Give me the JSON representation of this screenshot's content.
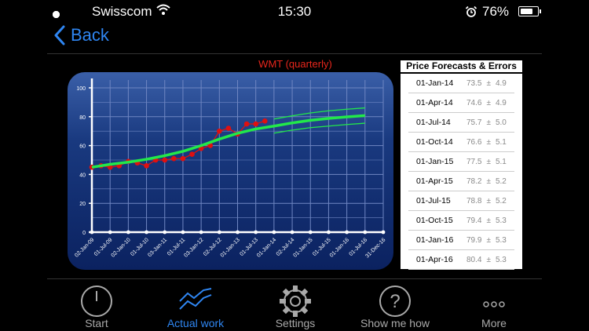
{
  "status": {
    "carrier": "Swisscom",
    "time": "15:30",
    "battery": "76%",
    "signal_bars": 2,
    "signal_max": 5,
    "battery_level": 0.76
  },
  "nav": {
    "back_label": "Back"
  },
  "chart_data": {
    "type": "line",
    "title": "WMT (quarterly)",
    "ylim": [
      0,
      100
    ],
    "y_ticks": [
      0,
      20,
      40,
      60,
      80,
      100
    ],
    "grid": true,
    "x_tick_labels": [
      "02-Jan-09",
      "01-Jul-09",
      "02-Jan-10",
      "01-Jul-10",
      "03-Jan-11",
      "01-Jul-11",
      "03-Jan-12",
      "02-Jul-12",
      "01-Jan-13",
      "01-Jul-13",
      "01-Jan-14",
      "02-Jul-14",
      "01-Jan-15",
      "01-Jul-15",
      "01-Jan-16",
      "01-Jul-16",
      "31-Dec-16"
    ],
    "series": [
      {
        "style": "observed",
        "color": "#e01010",
        "x": [
          0,
          0.5,
          1,
          1.5,
          2,
          2.5,
          3,
          3.5,
          4,
          4.5,
          5,
          5.5,
          6,
          6.5,
          7,
          7.5,
          8,
          8.5,
          9,
          9.5
        ],
        "values": [
          45,
          46,
          45,
          46,
          49,
          48,
          46,
          50,
          50,
          51,
          51,
          54,
          58,
          60,
          70,
          72,
          68,
          75,
          75,
          77
        ]
      },
      {
        "style": "fit",
        "color": "#22e84a",
        "x": [
          0,
          1,
          2,
          3,
          4,
          5,
          6,
          7,
          8,
          9,
          10,
          11,
          12,
          13,
          14,
          15
        ],
        "values": [
          45,
          47,
          48.5,
          50.5,
          53,
          56,
          60,
          64.5,
          68.5,
          71.5,
          73.5,
          75.7,
          77.5,
          78.8,
          79.9,
          80.8
        ]
      },
      {
        "style": "upper",
        "color": "#22e84a",
        "x": [
          10,
          11,
          12,
          13,
          14,
          15
        ],
        "values": [
          78.4,
          80.6,
          82.6,
          84.1,
          85.2,
          86.1
        ]
      },
      {
        "style": "lower",
        "color": "#22e84a",
        "x": [
          10,
          11,
          12,
          13,
          14,
          15
        ],
        "values": [
          68.6,
          70.7,
          72.4,
          73.5,
          74.6,
          75.5
        ]
      }
    ]
  },
  "forecast": {
    "title": "Price Forecasts & Errors",
    "pm": "±",
    "rows": [
      {
        "date": "01-Jan-14",
        "price": "73.5",
        "error": "4.9"
      },
      {
        "date": "01-Apr-14",
        "price": "74.6",
        "error": "4.9"
      },
      {
        "date": "01-Jul-14",
        "price": "75.7",
        "error": "5.0"
      },
      {
        "date": "01-Oct-14",
        "price": "76.6",
        "error": "5.1"
      },
      {
        "date": "01-Jan-15",
        "price": "77.5",
        "error": "5.1"
      },
      {
        "date": "01-Apr-15",
        "price": "78.2",
        "error": "5.2"
      },
      {
        "date": "01-Jul-15",
        "price": "78.8",
        "error": "5.2"
      },
      {
        "date": "01-Oct-15",
        "price": "79.4",
        "error": "5.3"
      },
      {
        "date": "01-Jan-16",
        "price": "79.9",
        "error": "5.3"
      },
      {
        "date": "01-Apr-16",
        "price": "80.4",
        "error": "5.3"
      }
    ]
  },
  "tabs": [
    {
      "label": "Start",
      "icon": "power-icon",
      "active": false
    },
    {
      "label": "Actual work",
      "icon": "trend-lines-icon",
      "active": true
    },
    {
      "label": "Settings",
      "icon": "gear-icon",
      "active": false
    },
    {
      "label": "Show me how",
      "icon": "help-icon",
      "active": false
    },
    {
      "label": "More",
      "icon": "more-icon",
      "active": false
    }
  ],
  "colors": {
    "accent": "#2f86f2",
    "chart_bg": "#0f2c75",
    "observed": "#e01010",
    "fit": "#22e84a",
    "title": "#e8261c"
  }
}
